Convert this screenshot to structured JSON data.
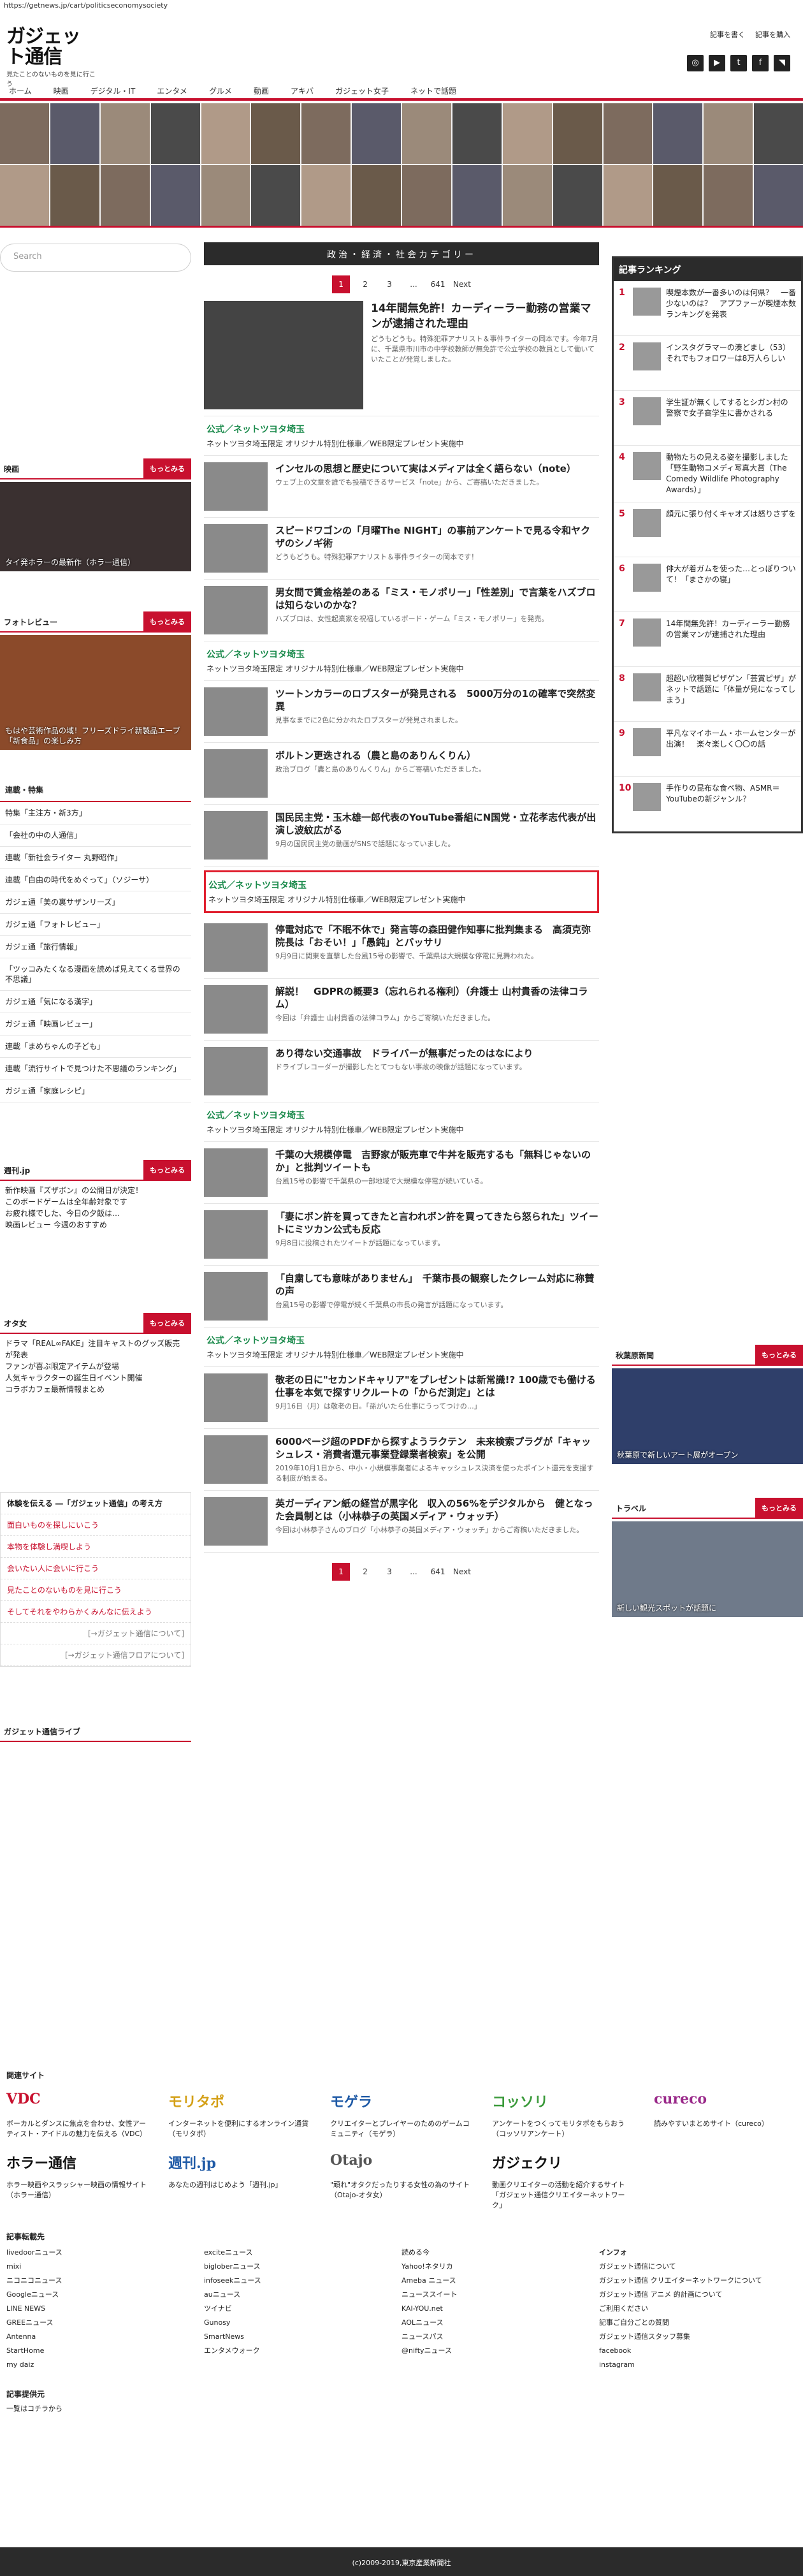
{
  "url": "https://getnews.jp/cart/politicseconomysociety",
  "logo": {
    "name": "ガジェット通信",
    "tagline": "見たことのないものを見に行こう"
  },
  "header_links": [
    "記事を書く",
    "記事を購入"
  ],
  "social": [
    "Instagram",
    "YouTube",
    "Twitter",
    "Facebook",
    "RSS"
  ],
  "nav": [
    "ホーム",
    "映画",
    "デジタル・IT",
    "エンタメ",
    "グルメ",
    "動画",
    "アキバ",
    "ガジェット女子",
    "ネットで話題"
  ],
  "search_placeholder": "Search",
  "section_title": "政治・経済・社会カテゴリー",
  "pager": [
    "1",
    "2",
    "3",
    "...",
    "641",
    "Next"
  ],
  "articles": [
    {
      "t": "14年間無免許！カーディーラー勤務の営業マンが逮捕された理由",
      "d": "どうもどうも。特殊犯罪アナリスト＆事件ライターの岡本です。今年7月に、千葉県市川市の中学校教師が無免許で公立学校の教員として働いていたことが発覚しました。"
    },
    {
      "ad": true,
      "t": "公式／ネットツヨタ埼玉",
      "d": "ネットツヨタ埼玉限定 オリジナル特別仕様車／WEB限定プレゼント実施中"
    },
    {
      "t": "インセルの思想と歴史について実はメディアは全く語らない（note）",
      "d": "ウェブ上の文章を誰でも投稿できるサービス「note」から、ご寄稿いただきました。"
    },
    {
      "t": "スピードワゴンの「月曜The NIGHT」の事前アンケートで見る令和ヤクザのシノギ術",
      "d": "どうもどうも。特殊犯罪アナリスト＆事件ライターの岡本です！"
    },
    {
      "t": "男女間で賃金格差のある「ミス・モノポリー」「性差別」で言葉をハズブロは知らないのかな？",
      "d": "ハズブロは、女性起業家を祝福しているボード・ゲーム「ミス・モノポリー」を発売。"
    },
    {
      "ad": true,
      "t": "公式／ネットツヨタ埼玉",
      "d": "ネットツヨタ埼玉限定 オリジナル特別仕様車／WEB限定プレゼント実施中"
    },
    {
      "t": "ツートンカラーのロブスターが発見される　5000万分の1の確率で突然変異",
      "d": "見事なまでに2色に分かれたロブスターが発見されました。"
    },
    {
      "t": "ボルトン更迭される（農と島のありんくりん）",
      "d": "政治ブログ「農と島のありんくりん」からご寄稿いただきました。"
    },
    {
      "t": "国民民主党・玉木雄一郎代表のYouTube番組にN国党・立花孝志代表が出演し波紋広がる",
      "d": "9月の国民民主党の動画がSNSで話題になっていました。"
    },
    {
      "ad": true,
      "red": true,
      "t": "公式／ネットツヨタ埼玉",
      "d": "ネットツヨタ埼玉限定 オリジナル特別仕様車／WEB限定プレゼント実施中"
    },
    {
      "t": "停電対応で「不眠不休で」発言等の森田健作知事に批判集まる　高須克弥院長は「おそい！」「愚鈍」とバッサリ",
      "d": "9月9日に関東を直撃した台風15号の影響で、千葉県は大規模な停電に見舞われた。"
    },
    {
      "t": "解説！　GDPRの概要3（忘れられる権利）（弁護士 山村貴香の法律コラム）",
      "d": "今回は「弁護士 山村貴香の法律コラム」からご寄稿いただきました。"
    },
    {
      "t": "あり得ない交通事故　ドライバーが無事だったのはなにより",
      "d": "ドライブレコーダーが撮影したとてつもない事故の映像が話題になっています。"
    },
    {
      "ad": true,
      "t": "公式／ネットツヨタ埼玉",
      "d": "ネットツヨタ埼玉限定 オリジナル特別仕様車／WEB限定プレゼント実施中"
    },
    {
      "t": "千葉の大規模停電　吉野家が販売車で牛丼を販売するも「無料じゃないのか」と批判ツイートも",
      "d": "台風15号の影響で千葉県の一部地域で大規模な停電が続いている。"
    },
    {
      "t": "「妻にボン許を買ってきたと言われボン許を買ってきたら怒られた」ツイートにミツカン公式も反応",
      "d": "9月8日に投稿されたツイートが話題になっています。"
    },
    {
      "t": "「自粛しても意味がありません」　千葉市長の観察したクレーム対応に称賛の声",
      "d": "台風15号の影響で停電が続く千葉県の市長の発言が話題になっています。"
    },
    {
      "ad": true,
      "t": "公式／ネットツヨタ埼玉",
      "d": "ネットツヨタ埼玉限定 オリジナル特別仕様車／WEB限定プレゼント実施中"
    },
    {
      "t": "敬老の日に\"セカンドキャリア\"をプレゼントは新常識!? 100歳でも働ける仕事を本気で探すリクルートの「からだ測定」とは",
      "d": "9月16日（月）は敬老の日。「孫がいたら仕事にうってつけの…」"
    },
    {
      "t": "6000ページ超のPDFから探すようラクテン　未来検索プラグが「キャッシュレス・消費者還元事業登録業者検索」を公開",
      "d": "2019年10月1日から、中小・小規模事業者によるキャッシュレス決済を使ったポイント還元を支援する制度が始まる。"
    },
    {
      "t": "英ガーディアン紙の経営が黒字化　収入の56%をデジタルから　健となった会員制とは（小林恭子の英国メディア・ウォッチ）",
      "d": "今回は小林恭子さんのブログ「小林恭子の英国メディア・ウォッチ」からご寄稿いただきました。"
    }
  ],
  "ranking_title": "記事ランキング",
  "ranking": [
    "喫煙本数が一番多いのは何県？　一番少ないのは？　アプファーが喫煙本数ランキングを発表",
    "インスタグラマーの湊どまし（53）それでもフォロワーは8万人らしい",
    "学生証が無くしてするとシガン村の 警察で女子高学生に書かされる",
    "動物たちの見える姿を撮影しました「野生動物コメディ写真大賞（The Comedy Wildlife Photography Awards）」",
    "顔元に張り付くキャオズは怒りさずを",
    "俳大が着ガムを使った…とっぽりついて！「まさかの寝」",
    "14年間無免許！カーディーラー勤務の営業マンが逮捕された理由",
    "超超い欣穫賀ピザゲン「芸賞ピザ」がネットで話題に「体量が見になってしまう」",
    "平凡なマイホーム・ホームセンターが出演！　楽々楽しく〇〇の話",
    "手作りの昆布な食べ物、ASMR＝YouTubeの新ジャンル？"
  ],
  "left_boxes": {
    "movie": {
      "title": "映画",
      "more": "もっとみる",
      "cap": "タイ発ホラーの最新作（ホラー通信）"
    },
    "photo": {
      "title": "フォトレビュー",
      "more": "もっとみる",
      "cap": "もはや芸術作品の域！フリーズドライ新製品エーブ「新食品」の楽しみ方"
    }
  },
  "cat_title": "連載・特集",
  "cat_items": [
    "特集「主注方・新3方」",
    "「会社の中の人通信」",
    "連載「新社会ライター 丸野昭作」",
    "連載「自由の時代をめぐって」（ソジーサ）",
    "ガジェ通「美の裏サザンリーズ」",
    "ガジェ通「フォトレビュー」",
    "ガジェ通「旅行情報」",
    "「ツッコみたくなる漫画を読めば見えてくる世界の不思議」",
    "ガジェ通「気になる漢字」",
    "ガジェ通「映画レビュー」",
    "連載「まめちゃんの子ども」",
    "連載「流行サイトで見つけた不思議のランキング」",
    "ガジェ通「家庭レシピ」"
  ],
  "left_more": [
    {
      "title": "週刊.jp",
      "more": "もっとみる",
      "lines": [
        "新作映画『ズザボン』の公開日が決定！",
        "このボードゲームは全年齢対象です",
        "お疲れ様でした、今日の夕飯は…",
        "映画レビュー 今週のおすすめ"
      ]
    },
    {
      "title": "オタ女",
      "more": "もっとみる",
      "lines": [
        "ドラマ「REAL∞FAKE」注目キャストのグッズ販売が発表",
        "ファンが喜ぶ限定アイテムが登場",
        "人気キャラクターの誕生日イベント開催",
        "コラボカフェ最新情報まとめ"
      ]
    }
  ],
  "red_links": [
    "体験を伝える ―「ガジェット通信」の考え方",
    "面白いものを探しにいこう",
    "本物を体験し満喫しよう",
    "会いたい人に会いに行こう",
    "見たことのないものを見に行こう",
    "そしてそれをやわらかくみんなに伝えよう",
    "[→ガジェット通信について]",
    "[→ガジェット通信フロアについて]"
  ],
  "live_title": "ガジェット通信ライブ",
  "right_boxes": [
    {
      "title": "秋葉原新聞",
      "more": "もっとみる",
      "cap": "秋葉原で新しいアート展がオープン"
    },
    {
      "title": "トラベル",
      "more": "もっとみる",
      "cap": "新しい観光スポットが話題に"
    }
  ],
  "related_title": "関連サイト",
  "related": [
    {
      "logo": "VDC",
      "d": "ボーカルとダンスに焦点を合わせ、女性アーティスト・アイドルの魅力を伝える（VDC）"
    },
    {
      "logo": "モリタポ",
      "d": "インターネットを便利にするオンライン通貨（モリタポ）"
    },
    {
      "logo": "モゲラ",
      "d": "クリエイターとプレイヤーのためのゲームコミュニティ（モゲラ）"
    },
    {
      "logo": "コッソリ",
      "d": "アンケートをつくってモリタポをもらおう（コッソリアンケート）"
    },
    {
      "logo": "cureco",
      "d": "読みやすいまとめサイト（cureco）"
    },
    {
      "logo": "ホラー通信",
      "d": "ホラー映画やスラッシャー映画の情報サイト（ホラー通信）"
    },
    {
      "logo": "週刊.jp",
      "d": "あなたの週刊はじめよう「週刊.jp」"
    },
    {
      "logo": "Otajo",
      "d": "\"頑れ\"オタクだったりする女性の為のサイト（Otajo-オタ女）"
    },
    {
      "logo": "ガジェクリ",
      "d": "動画クリエイターの活動を紹介するサイト「ガジェット通信クリエイターネットワーク」"
    }
  ],
  "link_title": "記事転載先",
  "links": [
    [
      "livedoorニュース",
      "mixi",
      "ニコニコニュース",
      "Googleニュース",
      "LINE NEWS",
      "GREEニュース",
      "Antenna",
      "StartHome",
      "my daiz"
    ],
    [
      "exciteニュース",
      "bigloberニュース",
      "infoseekニュース",
      "auニュース",
      "ツイナビ",
      "Gunosy",
      "SmartNews",
      "エンタメウォーク"
    ],
    [
      "読める今",
      "Yahoo!ネタリカ",
      "Ameba ニュース",
      "ニューススイート",
      "KAI-YOU.net",
      "AOLニュース",
      "ニュースパス",
      "@niftyニュース"
    ],
    [
      "ガジェット通信について",
      "ガジェット通信 クリエイターネットワークについて",
      "ガジェット通信 アニメ 的計画について",
      "ご利用ください",
      "記事ご自分ごとの質問",
      "ガジェット通信スタッフ募集",
      "facebook",
      "instagram"
    ]
  ],
  "info_title": "インフォ",
  "provider_title": "記事提供元",
  "provider_link": "一覧はコチラから",
  "copyright": "(c)2009-2019,東京産業新聞社"
}
